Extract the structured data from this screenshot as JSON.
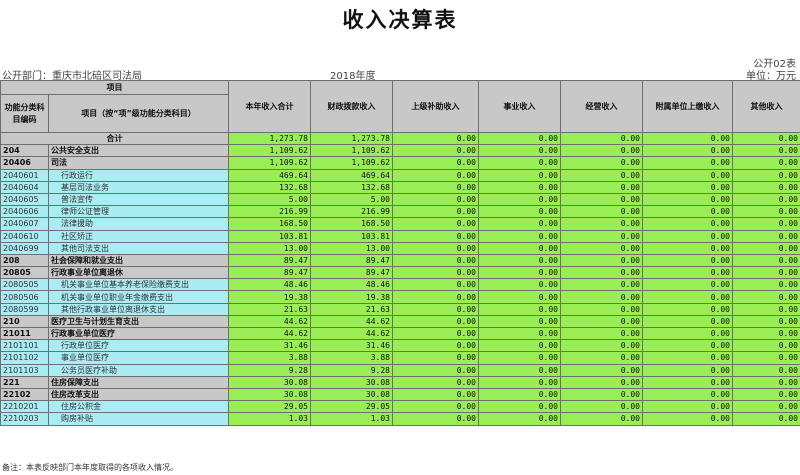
{
  "title": "收入决算表",
  "form_code": "公开02表",
  "dept_label": "公开部门：重庆市北碚区司法局",
  "year": "2018年度",
  "unit": "单位：万元",
  "headers": {
    "item": "项目",
    "code": "功能分类科目编码",
    "name": "项目（按“项”级功能分类科目）",
    "cols": [
      "本年收入合计",
      "财政拨款收入",
      "上级补助收入",
      "事业收入",
      "经营收入",
      "附属单位上缴收入",
      "其他收入"
    ]
  },
  "total": {
    "label": "合计",
    "values": [
      "1,273.78",
      "1,273.78",
      "0.00",
      "0.00",
      "0.00",
      "0.00",
      "0.00"
    ]
  },
  "rows": [
    {
      "code": "204",
      "name": "公共安全支出",
      "level": 1,
      "values": [
        "1,109.62",
        "1,109.62",
        "0.00",
        "0.00",
        "0.00",
        "0.00",
        "0.00"
      ]
    },
    {
      "code": "20406",
      "name": "司法",
      "level": 2,
      "values": [
        "1,109.62",
        "1,109.62",
        "0.00",
        "0.00",
        "0.00",
        "0.00",
        "0.00"
      ]
    },
    {
      "code": "2040601",
      "name": "行政运行",
      "level": 3,
      "values": [
        "469.64",
        "469.64",
        "0.00",
        "0.00",
        "0.00",
        "0.00",
        "0.00"
      ]
    },
    {
      "code": "2040604",
      "name": "基层司法业务",
      "level": 3,
      "values": [
        "132.68",
        "132.68",
        "0.00",
        "0.00",
        "0.00",
        "0.00",
        "0.00"
      ]
    },
    {
      "code": "2040605",
      "name": "普法宣传",
      "level": 3,
      "values": [
        "5.00",
        "5.00",
        "0.00",
        "0.00",
        "0.00",
        "0.00",
        "0.00"
      ]
    },
    {
      "code": "2040606",
      "name": "律师公证管理",
      "level": 3,
      "values": [
        "216.99",
        "216.99",
        "0.00",
        "0.00",
        "0.00",
        "0.00",
        "0.00"
      ]
    },
    {
      "code": "2040607",
      "name": "法律援助",
      "level": 3,
      "values": [
        "168.50",
        "168.50",
        "0.00",
        "0.00",
        "0.00",
        "0.00",
        "0.00"
      ]
    },
    {
      "code": "2040610",
      "name": "社区矫正",
      "level": 3,
      "values": [
        "103.81",
        "103.81",
        "0.00",
        "0.00",
        "0.00",
        "0.00",
        "0.00"
      ]
    },
    {
      "code": "2040699",
      "name": "其他司法支出",
      "level": 3,
      "values": [
        "13.00",
        "13.00",
        "0.00",
        "0.00",
        "0.00",
        "0.00",
        "0.00"
      ]
    },
    {
      "code": "208",
      "name": "社会保障和就业支出",
      "level": 1,
      "values": [
        "89.47",
        "89.47",
        "0.00",
        "0.00",
        "0.00",
        "0.00",
        "0.00"
      ]
    },
    {
      "code": "20805",
      "name": "行政事业单位离退休",
      "level": 2,
      "values": [
        "89.47",
        "89.47",
        "0.00",
        "0.00",
        "0.00",
        "0.00",
        "0.00"
      ]
    },
    {
      "code": "2080505",
      "name": "机关事业单位基本养老保险缴费支出",
      "level": 3,
      "values": [
        "48.46",
        "48.46",
        "0.00",
        "0.00",
        "0.00",
        "0.00",
        "0.00"
      ]
    },
    {
      "code": "2080506",
      "name": "机关事业单位职业年金缴费支出",
      "level": 3,
      "values": [
        "19.38",
        "19.38",
        "0.00",
        "0.00",
        "0.00",
        "0.00",
        "0.00"
      ]
    },
    {
      "code": "2080599",
      "name": "其他行政事业单位离退休支出",
      "level": 3,
      "values": [
        "21.63",
        "21.63",
        "0.00",
        "0.00",
        "0.00",
        "0.00",
        "0.00"
      ]
    },
    {
      "code": "210",
      "name": "医疗卫生与计划生育支出",
      "level": 1,
      "values": [
        "44.62",
        "44.62",
        "0.00",
        "0.00",
        "0.00",
        "0.00",
        "0.00"
      ]
    },
    {
      "code": "21011",
      "name": "行政事业单位医疗",
      "level": 2,
      "values": [
        "44.62",
        "44.62",
        "0.00",
        "0.00",
        "0.00",
        "0.00",
        "0.00"
      ]
    },
    {
      "code": "2101101",
      "name": "行政单位医疗",
      "level": 3,
      "values": [
        "31.46",
        "31.46",
        "0.00",
        "0.00",
        "0.00",
        "0.00",
        "0.00"
      ]
    },
    {
      "code": "2101102",
      "name": "事业单位医疗",
      "level": 3,
      "values": [
        "3.88",
        "3.88",
        "0.00",
        "0.00",
        "0.00",
        "0.00",
        "0.00"
      ]
    },
    {
      "code": "2101103",
      "name": "公务员医疗补助",
      "level": 3,
      "values": [
        "9.28",
        "9.28",
        "0.00",
        "0.00",
        "0.00",
        "0.00",
        "0.00"
      ]
    },
    {
      "code": "221",
      "name": "住房保障支出",
      "level": 1,
      "values": [
        "30.08",
        "30.08",
        "0.00",
        "0.00",
        "0.00",
        "0.00",
        "0.00"
      ]
    },
    {
      "code": "22102",
      "name": "住房改革支出",
      "level": 2,
      "values": [
        "30.08",
        "30.08",
        "0.00",
        "0.00",
        "0.00",
        "0.00",
        "0.00"
      ]
    },
    {
      "code": "2210201",
      "name": "住房公积金",
      "level": 3,
      "values": [
        "29.05",
        "29.05",
        "0.00",
        "0.00",
        "0.00",
        "0.00",
        "0.00"
      ]
    },
    {
      "code": "2210203",
      "name": "购房补贴",
      "level": 3,
      "values": [
        "1.03",
        "1.03",
        "0.00",
        "0.00",
        "0.00",
        "0.00",
        "0.00"
      ]
    }
  ],
  "note": "备注：本表反映部门本年度取得的各项收入情况。"
}
